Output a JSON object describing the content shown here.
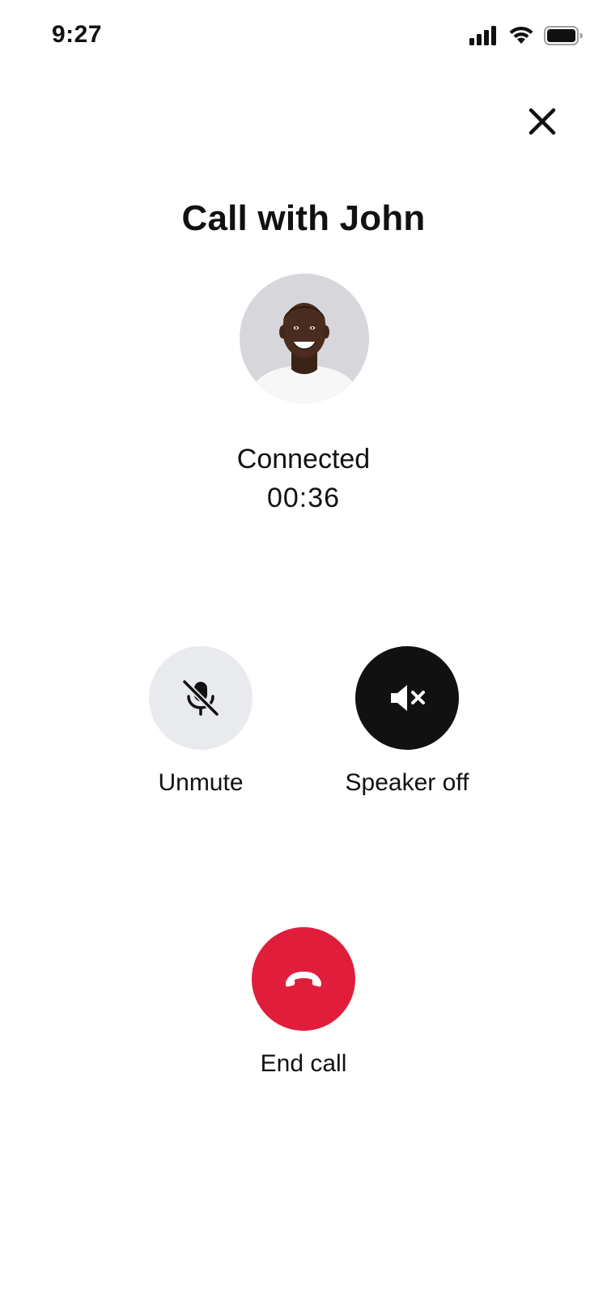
{
  "status_bar": {
    "time": "9:27",
    "icons": [
      "signal-icon",
      "wifi-icon",
      "battery-icon"
    ]
  },
  "header": {
    "close_icon": "close-icon"
  },
  "call": {
    "title": "Call with John",
    "status": "Connected",
    "timer": "00:36"
  },
  "controls": {
    "mute": {
      "label": "Unmute",
      "icon": "mic-off-icon"
    },
    "speaker": {
      "label": "Speaker off",
      "icon": "speaker-off-icon"
    },
    "end": {
      "label": "End call",
      "icon": "hang-up-icon"
    }
  },
  "colors": {
    "end_call_red": "#e01e3c",
    "dark_button": "#111111",
    "light_button": "#e9eaee"
  }
}
